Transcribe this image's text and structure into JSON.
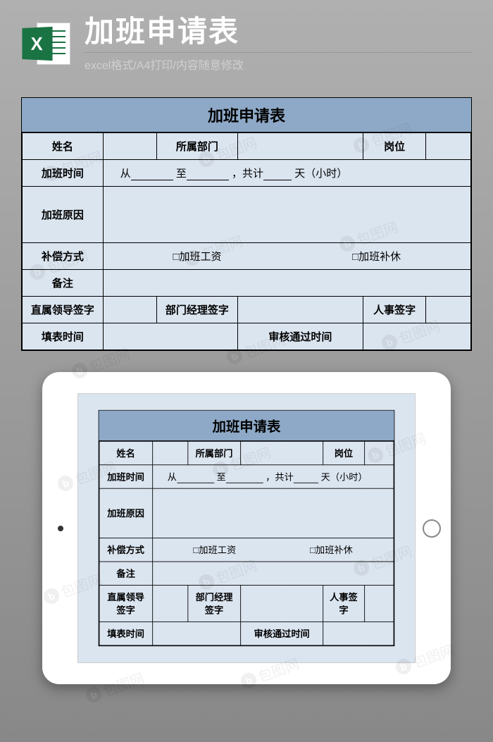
{
  "header": {
    "icon_letter": "X",
    "title": "加班申请表",
    "subtitle": "excel格式/A4打印/内容随意修改"
  },
  "form": {
    "title": "加班申请表",
    "name_label": "姓名",
    "dept_label": "所属部门",
    "position_label": "岗位",
    "overtime_time_label": "加班时间",
    "time_from": "从",
    "time_to": "至",
    "time_total_prefix": "，共计",
    "time_total_suffix": "天（小时）",
    "reason_label": "加班原因",
    "compensation_label": "补偿方式",
    "compensation_salary": "□加班工资",
    "compensation_leave": "□加班补休",
    "remark_label": "备注",
    "direct_leader_label": "直属领导签字",
    "dept_manager_label": "部门经理签字",
    "hr_label": "人事签字",
    "fill_time_label": "填表时间",
    "approve_time_label": "审核通过时间"
  },
  "watermark": {
    "text": "包图网",
    "logo": "b"
  }
}
